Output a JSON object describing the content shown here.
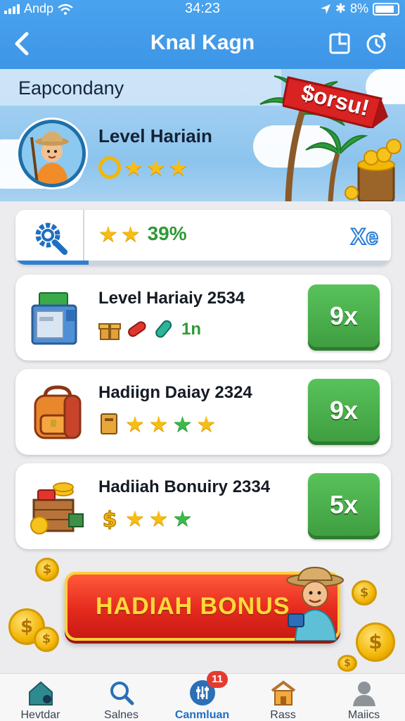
{
  "status_bar": {
    "carrier": "Andp",
    "time": "34:23",
    "battery": "8%"
  },
  "header": {
    "title": "Knal Kagn"
  },
  "banner": {
    "subtitle": "Eapcondany",
    "level_name": "Level Hariain",
    "stars": 3,
    "flag_text": "$orsu!"
  },
  "progress": {
    "stars": 2,
    "percent_label": "39%",
    "value": 0.39,
    "right_label": "Xe"
  },
  "rewards": [
    {
      "title": "Level Hariaiy  2534",
      "icon": "cash-register-icon",
      "sub_icons": [
        "gift-box-icon",
        "red-candy-icon",
        "teal-candy-icon"
      ],
      "count": "1n",
      "button": "9x"
    },
    {
      "title": "Hadiign Daiay 2324",
      "icon": "backpack-icon",
      "sub_icons": [
        "book-icon"
      ],
      "stars": [
        "gold",
        "gold",
        "green",
        "gold"
      ],
      "button": "9x"
    },
    {
      "title": "Hadiiah Bonuiry 2334",
      "icon": "treasure-crate-icon",
      "sub_icons": [
        "dollar-icon"
      ],
      "stars": [
        "gold",
        "gold",
        "green"
      ],
      "button": "5x"
    }
  ],
  "bonus_button": {
    "label": "HADIAH BONUS"
  },
  "nav": [
    {
      "label": "Hevtdar",
      "icon": "home-icon"
    },
    {
      "label": "Salnes",
      "icon": "search-icon"
    },
    {
      "label": "Canmluan",
      "icon": "sliders-icon",
      "badge": "11",
      "active": true
    },
    {
      "label": "Rass",
      "icon": "shop-icon"
    },
    {
      "label": "Maiics",
      "icon": "profile-icon"
    }
  ],
  "colors": {
    "header_blue": "#3d95e6",
    "claim_green": "#4caf50",
    "bonus_red": "#e52a1e",
    "gold": "#f6bd14",
    "progress_green": "#2e9a36"
  }
}
